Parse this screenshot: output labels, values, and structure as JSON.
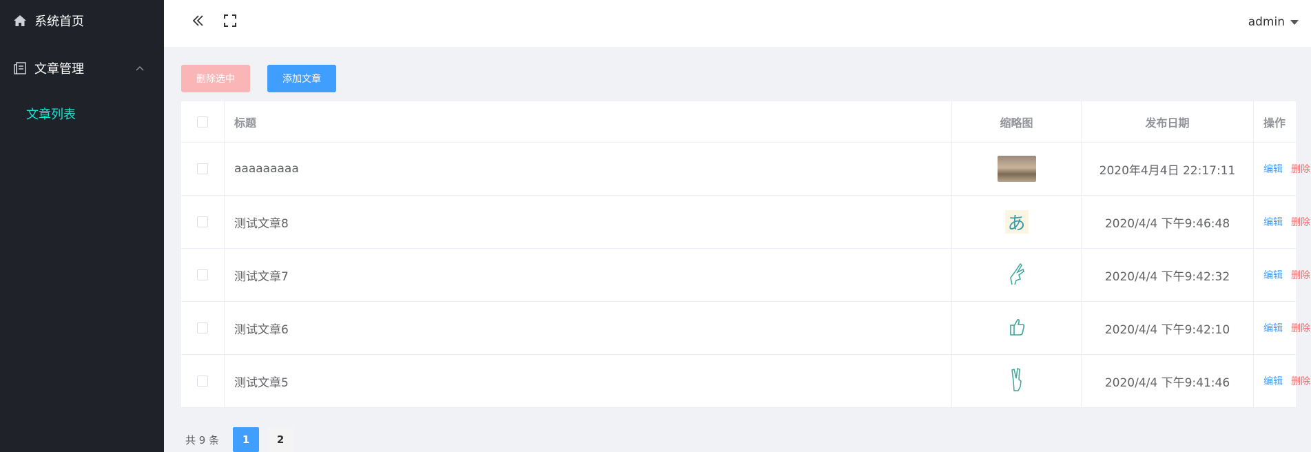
{
  "sidebar": {
    "home_label": "系统首页",
    "article_mgmt_label": "文章管理",
    "article_list_label": "文章列表"
  },
  "header": {
    "username": "admin"
  },
  "toolbar": {
    "delete_selected_label": "删除选中",
    "add_article_label": "添加文章"
  },
  "table": {
    "columns": {
      "title": "标题",
      "thumb": "缩略图",
      "date": "发布日期",
      "ops": "操作"
    },
    "rows": [
      {
        "title": "aaaaaaaaa",
        "thumb": "photo",
        "date": "2020年4月4日 22:17:11",
        "edit": "编辑",
        "delete": "删除"
      },
      {
        "title": "测试文章8",
        "thumb": "kana",
        "thumb_text": "あ",
        "date": "2020/4/4 下午9:46:48",
        "edit": "编辑",
        "delete": "删除"
      },
      {
        "title": "测试文章7",
        "thumb": "hand-gesture-1",
        "date": "2020/4/4 下午9:42:32",
        "edit": "编辑",
        "delete": "删除"
      },
      {
        "title": "测试文章6",
        "thumb": "thumbs-up",
        "date": "2020/4/4 下午9:42:10",
        "edit": "编辑",
        "delete": "删除"
      },
      {
        "title": "测试文章5",
        "thumb": "victory-hand",
        "date": "2020/4/4 下午9:41:46",
        "edit": "编辑",
        "delete": "删除"
      }
    ]
  },
  "pagination": {
    "total_text": "共 9 条",
    "pages": [
      "1",
      "2"
    ],
    "current": "1"
  },
  "colors": {
    "sidebar_bg": "#20222a",
    "active_menu": "#1fe0d3",
    "primary": "#409eff",
    "danger": "#f56c6c"
  }
}
